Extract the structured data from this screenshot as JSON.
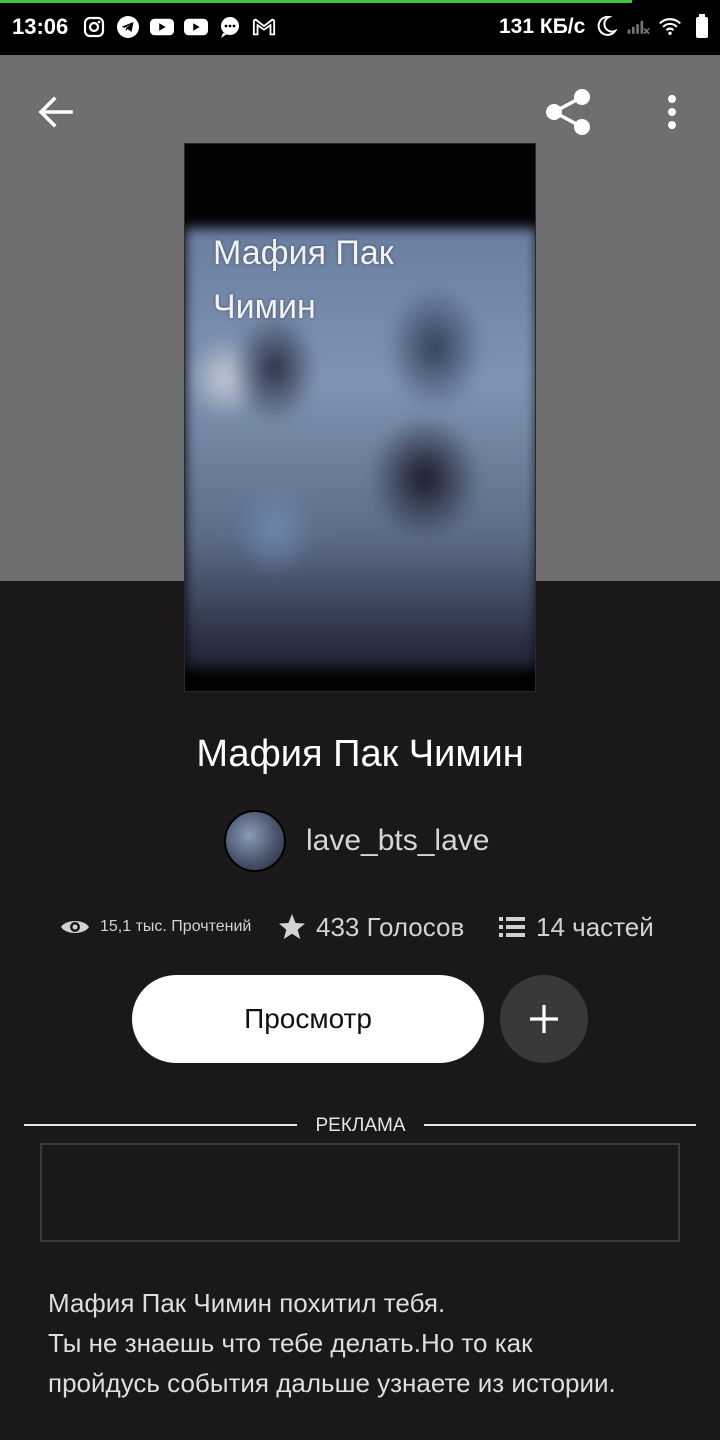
{
  "status_bar": {
    "time": "13:06",
    "network_speed": "131 КБ/с",
    "left_icons": [
      "instagram-icon",
      "telegram-icon",
      "youtube-icon",
      "youtube-icon",
      "chat-icon",
      "gmail-icon"
    ],
    "right_icons": [
      "moon-icon",
      "signal-icon",
      "wifi-icon",
      "battery-icon"
    ]
  },
  "toolbar": {
    "back_icon": "arrow-left-icon",
    "share_icon": "share-icon",
    "more_icon": "more-vertical-icon"
  },
  "cover": {
    "title_line1": "Мафия Пак",
    "title_line2": "Чимин"
  },
  "story": {
    "title": "Мафия Пак Чимин",
    "author": "lave_bts_lave"
  },
  "stats": {
    "reads": "15,1 тыс. Прочтений",
    "votes": "433 Голосов",
    "parts": "14 частей"
  },
  "actions": {
    "read_label": "Просмотр",
    "add_icon": "plus-icon"
  },
  "ad": {
    "label": "РЕКЛАМА"
  },
  "description": {
    "line1": "Мафия Пак Чимин похитил тебя.",
    "line2": "Ты не знаешь что тебе делать.Но то как",
    "line3": "пройдусь события дальше узнаете из истории."
  },
  "colors": {
    "header_bg": "#6f6e71",
    "page_bg": "#1a181b",
    "progress": "#3ec63a",
    "button_bg": "#ffffff",
    "add_button_bg": "#3a383b"
  }
}
